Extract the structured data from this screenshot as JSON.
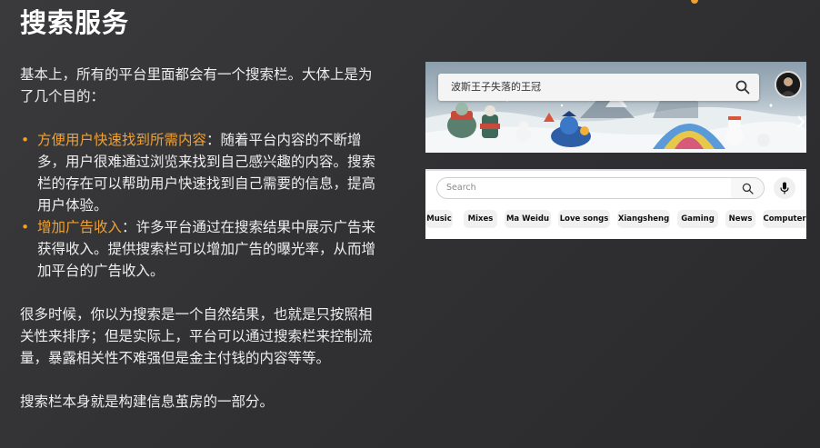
{
  "slide": {
    "title": "搜索服务",
    "intro": "基本上，所有的平台里面都会有一个搜索栏。大体上是为了几个目的：",
    "bullets": [
      {
        "highlight": "方便用户快速找到所需内容",
        "text": "：随着平台内容的不断增多，用户很难通过浏览来找到自己感兴趣的内容。搜索栏的存在可以帮助用户快速找到自己需要的信息，提高用户体验。"
      },
      {
        "highlight": "增加广告收入",
        "text": "：许多平台通过在搜索结果中展示广告来获得收入。提供搜索栏可以增加广告的曝光率，从而增加平台的广告收入。"
      }
    ],
    "paragraph2": "很多时候，你以为搜索是一个自然结果，也就是只按照相关性来排序；但是实际上，平台可以通过搜索栏来控制流量，暴露相关性不难强但是金主付钱的内容等等。",
    "paragraph3": "搜索栏本身就是构建信息茧房的一部分。",
    "colors": {
      "accent": "#f0a030",
      "text": "#eeeeee",
      "background": "#333335"
    }
  },
  "screenshot1": {
    "search_text": "波斯王子失落的王冠",
    "search_icon": "search-icon",
    "avatar_icon": "avatar"
  },
  "screenshot2": {
    "placeholder": "Search",
    "chips": [
      "Music",
      "Mixes",
      "Ma Weidu",
      "Love songs",
      "Xiangsheng",
      "Gaming",
      "News",
      "Computer"
    ]
  }
}
